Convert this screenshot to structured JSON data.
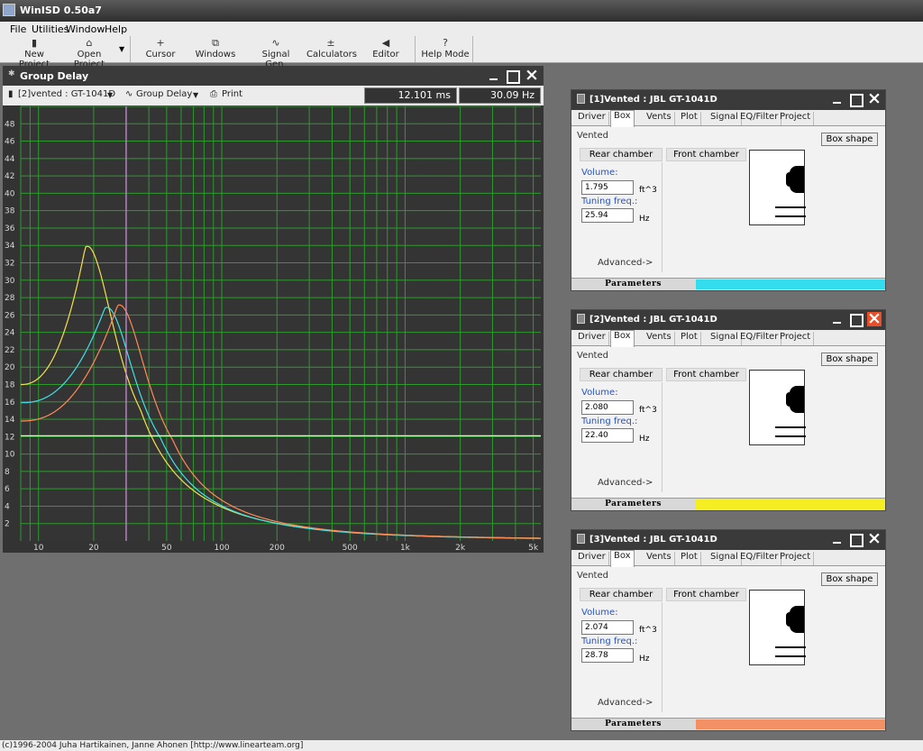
{
  "app": {
    "title": "WinISD 0.50a7"
  },
  "menu": [
    "File",
    "Utilities",
    "Window",
    "Help"
  ],
  "toolbar": {
    "new_project": "New Project",
    "open_project": "Open Project",
    "cursor": "Cursor",
    "windows": "Windows",
    "signal_gen": "Signal Gen.",
    "calculators": "Calculators",
    "editor": "Editor",
    "help_mode": "Help Mode"
  },
  "group_delay": {
    "title": "Group Delay",
    "project_select": "[2]vented : GT-1041D",
    "graph_select": "Group Delay",
    "print": "Print",
    "readout_time": "12.101 ms",
    "readout_freq": "30.09 Hz"
  },
  "chart_data": {
    "type": "line",
    "title": "",
    "xlabel": "",
    "ylabel": "",
    "x_scale": "log",
    "xlim": [
      8,
      5500
    ],
    "ylim": [
      0,
      50
    ],
    "grid": true,
    "x_ticks": [
      "10",
      "20",
      "50",
      "100",
      "200",
      "500",
      "1k",
      "2k",
      "5k"
    ],
    "x_tick_values": [
      10,
      20,
      50,
      100,
      200,
      500,
      1000,
      2000,
      5000
    ],
    "y_ticks": [
      2,
      4,
      6,
      8,
      10,
      12,
      14,
      16,
      18,
      20,
      22,
      24,
      26,
      28,
      30,
      32,
      34,
      36,
      38,
      40,
      42,
      44,
      46,
      48
    ],
    "cursor_x": 30.09,
    "cursor_y": 12.101,
    "series": [
      {
        "color": "#f5e14a",
        "fc": 18.0,
        "peak": 33.8,
        "base": 18.0,
        "x": [
          8,
          18,
          50,
          100,
          200,
          500,
          1000,
          5000
        ],
        "y": [
          18.0,
          33.8,
          5.5,
          3.2,
          1.5,
          0.5,
          0.2,
          0.1
        ]
      },
      {
        "color": "#3fe0e6",
        "fc": 23.0,
        "peak": 26.8,
        "base": 15.9,
        "x": [
          8,
          23,
          50,
          100,
          200,
          500,
          1000,
          5000
        ],
        "y": [
          15.9,
          26.8,
          6.5,
          3.2,
          1.5,
          0.5,
          0.2,
          0.1
        ]
      },
      {
        "color": "#ff8a55",
        "fc": 27.0,
        "peak": 27.1,
        "base": 13.8,
        "x": [
          8,
          27,
          50,
          100,
          200,
          500,
          1000,
          5000
        ],
        "y": [
          13.8,
          27.1,
          6.8,
          3.2,
          1.5,
          0.5,
          0.2,
          0.1
        ]
      }
    ]
  },
  "param_windows": [
    {
      "title": "[1]Vented : JBL GT-1041D",
      "tabs": [
        "Driver",
        "Box",
        "Vents",
        "Plot",
        "Signal",
        "EQ/Filter",
        "Project"
      ],
      "active_tab": "Box",
      "box_type": "Vented",
      "box_shape_button": "Box shape",
      "rear_chamber": "Rear chamber",
      "front_chamber": "Front chamber",
      "volume_label": "Volume:",
      "volume": "1.795",
      "volume_unit": "ft^3",
      "tuning_label": "Tuning freq.:",
      "tuning": "25.94",
      "tuning_unit": "Hz",
      "advanced": "Advanced->",
      "status": "Parameters",
      "color": "#33ddee",
      "close_color": ""
    },
    {
      "title": "[2]Vented : JBL GT-1041D",
      "tabs": [
        "Driver",
        "Box",
        "Vents",
        "Plot",
        "Signal",
        "EQ/Filter",
        "Project"
      ],
      "active_tab": "Box",
      "box_type": "Vented",
      "box_shape_button": "Box shape",
      "rear_chamber": "Rear chamber",
      "front_chamber": "Front chamber",
      "volume_label": "Volume:",
      "volume": "2.080",
      "volume_unit": "ft^3",
      "tuning_label": "Tuning freq.:",
      "tuning": "22.40",
      "tuning_unit": "Hz",
      "advanced": "Advanced->",
      "status": "Parameters",
      "color": "#f5ee22",
      "close_color": "#e84e2a"
    },
    {
      "title": "[3]Vented : JBL GT-1041D",
      "tabs": [
        "Driver",
        "Box",
        "Vents",
        "Plot",
        "Signal",
        "EQ/Filter",
        "Project"
      ],
      "active_tab": "Box",
      "box_type": "Vented",
      "box_shape_button": "Box shape",
      "rear_chamber": "Rear chamber",
      "front_chamber": "Front chamber",
      "volume_label": "Volume:",
      "volume": "2.074",
      "volume_unit": "ft^3",
      "tuning_label": "Tuning freq.:",
      "tuning": "28.78",
      "tuning_unit": "Hz",
      "advanced": "Advanced->",
      "status": "Parameters",
      "color": "#f39064",
      "close_color": ""
    }
  ],
  "footer": "(c)1996-2004 Juha Hartikainen, Janne Ahonen [http://www.linearteam.org]"
}
